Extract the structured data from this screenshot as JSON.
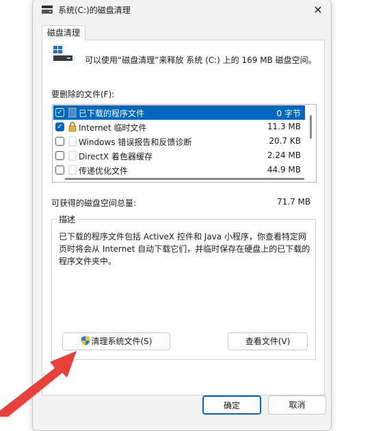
{
  "window": {
    "title": "系统(C:)的磁盘清理",
    "close_glyph": "✕",
    "tab_label": "磁盘清理"
  },
  "summary": "可以使用“磁盘清理”来释放 系统 (C:) 上的 169 MB 磁盘空间。",
  "files_label": "要删除的文件(F):",
  "files": [
    {
      "name": "已下载的程序文件",
      "size": "0 字节",
      "checked": true,
      "icon": "folder-icon"
    },
    {
      "name": "Internet 临时文件",
      "size": "11.3 MB",
      "checked": true,
      "icon": "lock-icon"
    },
    {
      "name": "Windows 错误报告和反馈诊断",
      "size": "20.7 KB",
      "checked": false,
      "icon": "file-icon"
    },
    {
      "name": "DirectX 着色器缓存",
      "size": "2.24 MB",
      "checked": false,
      "icon": "file-icon"
    },
    {
      "name": "传递优化文件",
      "size": "44.9 MB",
      "checked": false,
      "icon": "file-icon"
    }
  ],
  "total": {
    "label": "可获得的磁盘空间总量:",
    "value": "71.7 MB"
  },
  "description": {
    "legend": "描述",
    "text": "已下载的程序文件包括 ActiveX 控件和 Java 小程序，你查看特定网页时将会从 Internet 自动下载它们，并临时保存在硬盘上的已下载的程序文件夹中。"
  },
  "buttons": {
    "clean_system": "清理系统文件(S)",
    "view_files": "查看文件(V)",
    "ok": "确定",
    "cancel": "取消"
  },
  "colors": {
    "accent": "#0067c0",
    "arrow": "#e8413c"
  }
}
